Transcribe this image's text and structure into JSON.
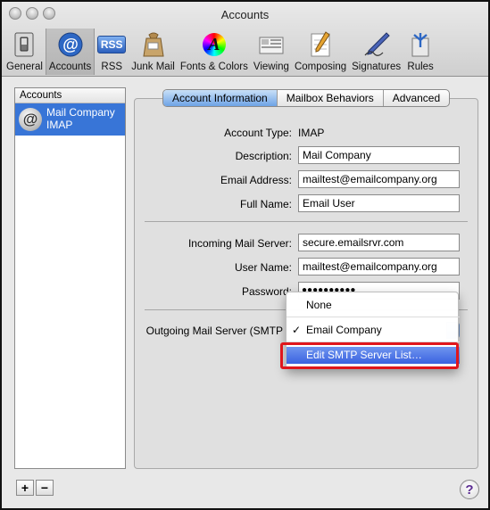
{
  "window": {
    "title": "Accounts"
  },
  "toolbar": {
    "items": [
      {
        "label": "General",
        "icon": "light-switch-icon"
      },
      {
        "label": "Accounts",
        "icon": "at-sign-icon"
      },
      {
        "label": "RSS",
        "icon": "rss-icon",
        "glyph": "RSS"
      },
      {
        "label": "Junk Mail",
        "icon": "junk-mail-bag-icon"
      },
      {
        "label": "Fonts & Colors",
        "icon": "fonts-colors-icon",
        "glyph": "A"
      },
      {
        "label": "Viewing",
        "icon": "viewing-icon"
      },
      {
        "label": "Composing",
        "icon": "composing-pencil-icon"
      },
      {
        "label": "Signatures",
        "icon": "signature-pen-icon"
      },
      {
        "label": "Rules",
        "icon": "rules-icon"
      }
    ]
  },
  "sidebar": {
    "header": "Accounts",
    "accounts": [
      {
        "name": "Mail Company",
        "type": "IMAP",
        "icon": "at-sign-icon",
        "glyph": "@"
      }
    ],
    "add_label": "+",
    "remove_label": "−"
  },
  "tabs": [
    "Account Information",
    "Mailbox Behaviors",
    "Advanced"
  ],
  "form": {
    "account_type_label": "Account Type:",
    "account_type_value": "IMAP",
    "description_label": "Description:",
    "description_value": "Mail Company",
    "email_label": "Email Address:",
    "email_value": "mailtest@emailcompany.org",
    "fullname_label": "Full Name:",
    "fullname_value": "Email User",
    "incoming_label": "Incoming Mail Server:",
    "incoming_value": "secure.emailsrvr.com",
    "username_label": "User Name:",
    "username_value": "mailtest@emailcompany.org",
    "password_label": "Password:",
    "password_value": "●●●●●●●●●●",
    "outgoing_label": "Outgoing Mail Server (SMTP"
  },
  "smtp_menu": {
    "items": [
      "None",
      "Email Company",
      "Edit SMTP Server List…"
    ],
    "checked_mark": "✓",
    "highlight_color": "#3a62e0",
    "annotation_color": "#e0161c"
  },
  "help": {
    "label": "?"
  }
}
